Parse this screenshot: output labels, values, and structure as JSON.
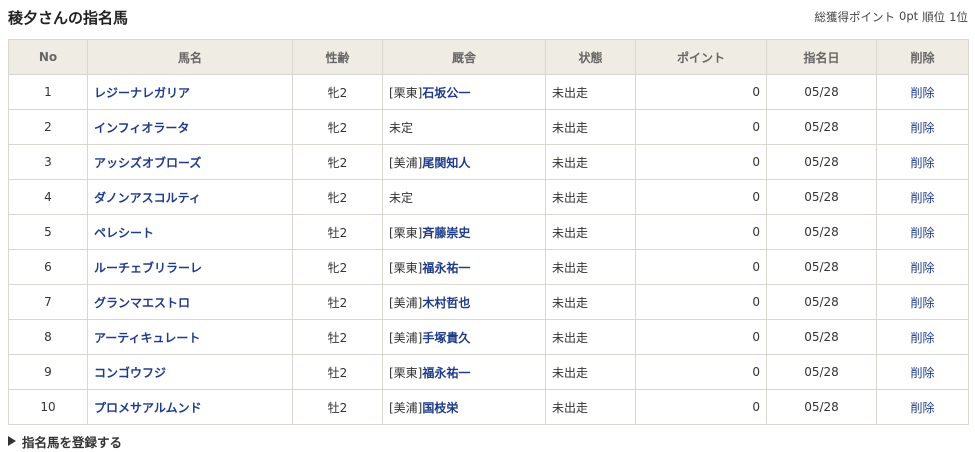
{
  "page": {
    "title": "稜夕さんの指名馬",
    "total_points_label": "総獲得ポイント",
    "total_points": "0pt",
    "rank_label": "順位",
    "rank": "1位"
  },
  "table": {
    "columns": [
      "No",
      "馬名",
      "性齢",
      "厩舎",
      "状態",
      "ポイント",
      "指名日",
      "削除"
    ],
    "rows": [
      {
        "no": "1",
        "name": "レジーナレガリア",
        "sex_age": "牝2",
        "stable_region": "[栗東]",
        "trainer": "石坂公一",
        "status": "未出走",
        "points": "0",
        "date": "05/28",
        "delete": "削除"
      },
      {
        "no": "2",
        "name": "インフィオラータ",
        "sex_age": "牝2",
        "stable_region": "未定",
        "trainer": "",
        "status": "未出走",
        "points": "0",
        "date": "05/28",
        "delete": "削除"
      },
      {
        "no": "3",
        "name": "アッシズオブローズ",
        "sex_age": "牝2",
        "stable_region": "[美浦]",
        "trainer": "尾関知人",
        "status": "未出走",
        "points": "0",
        "date": "05/28",
        "delete": "削除"
      },
      {
        "no": "4",
        "name": "ダノンアスコルティ",
        "sex_age": "牝2",
        "stable_region": "未定",
        "trainer": "",
        "status": "未出走",
        "points": "0",
        "date": "05/28",
        "delete": "削除"
      },
      {
        "no": "5",
        "name": "ペレシート",
        "sex_age": "牡2",
        "stable_region": "[栗東]",
        "trainer": "斉藤崇史",
        "status": "未出走",
        "points": "0",
        "date": "05/28",
        "delete": "削除"
      },
      {
        "no": "6",
        "name": "ルーチェブリラーレ",
        "sex_age": "牝2",
        "stable_region": "[栗東]",
        "trainer": "福永祐一",
        "status": "未出走",
        "points": "0",
        "date": "05/28",
        "delete": "削除"
      },
      {
        "no": "7",
        "name": "グランマエストロ",
        "sex_age": "牡2",
        "stable_region": "[美浦]",
        "trainer": "木村哲也",
        "status": "未出走",
        "points": "0",
        "date": "05/28",
        "delete": "削除"
      },
      {
        "no": "8",
        "name": "アーティキュレート",
        "sex_age": "牡2",
        "stable_region": "[美浦]",
        "trainer": "手塚貴久",
        "status": "未出走",
        "points": "0",
        "date": "05/28",
        "delete": "削除"
      },
      {
        "no": "9",
        "name": "コンゴウフジ",
        "sex_age": "牡2",
        "stable_region": "[栗東]",
        "trainer": "福永祐一",
        "status": "未出走",
        "points": "0",
        "date": "05/28",
        "delete": "削除"
      },
      {
        "no": "10",
        "name": "プロメサアルムンド",
        "sex_age": "牡2",
        "stable_region": "[美浦]",
        "trainer": "国枝栄",
        "status": "未出走",
        "points": "0",
        "date": "05/28",
        "delete": "削除"
      }
    ]
  },
  "register_link": {
    "label": "指名馬を登録する",
    "icon": "triangle-right-icon"
  },
  "colors": {
    "link": "#1f3c8a",
    "header_bg": "#efece3",
    "border": "#d9d6cf"
  }
}
